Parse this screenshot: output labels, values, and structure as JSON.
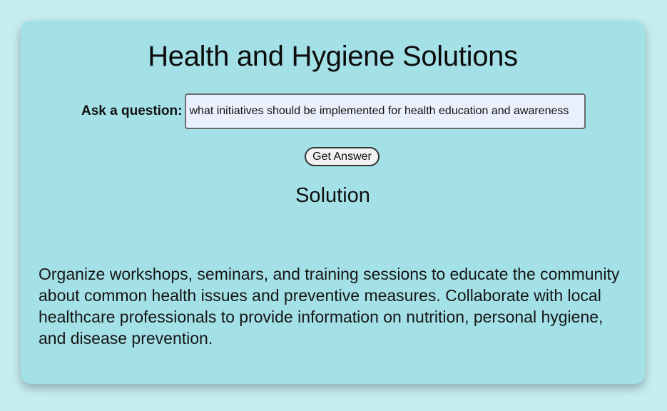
{
  "page": {
    "title": "Health and Hygiene Solutions"
  },
  "form": {
    "label": "Ask a question:",
    "input_value": "what initiatives should be implemented for health education and awareness",
    "button_label": "Get Answer"
  },
  "solution": {
    "heading": "Solution",
    "text": "Organize workshops, seminars, and training sessions to educate the community about common health issues and preventive measures. Collaborate with local healthcare professionals to provide information on nutrition, personal hygiene, and disease prevention."
  },
  "colors": {
    "page_background": "#c6eef0",
    "card_background": "#a4e1e7",
    "input_background": "#eaf0fb"
  }
}
